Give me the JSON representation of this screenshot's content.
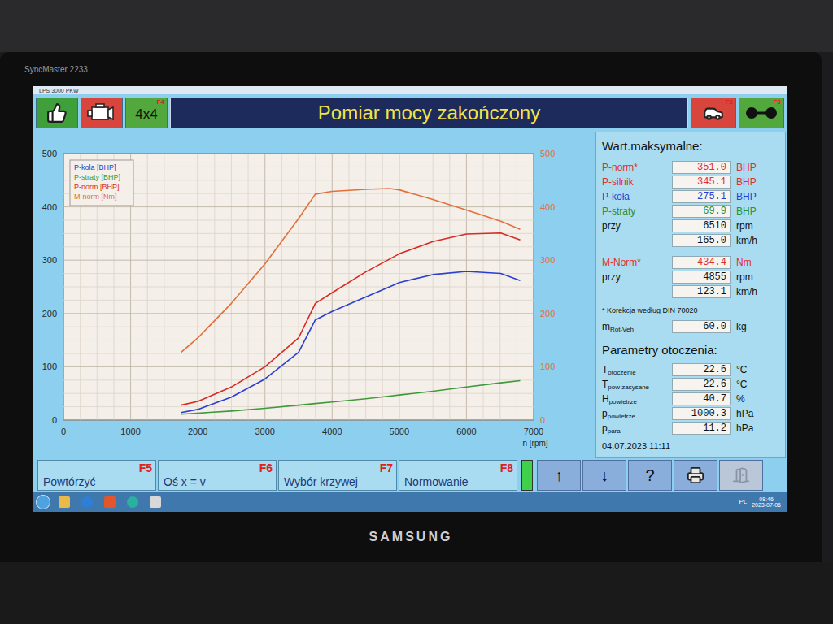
{
  "monitor": {
    "model": "SyncMaster 2233",
    "brand": "SAMSUNG"
  },
  "window": {
    "title": "LPS 3000 PKW"
  },
  "toolbar": {
    "left_buttons": [
      {
        "kind": "ok",
        "color": "#3f9f3a"
      },
      {
        "kind": "engine",
        "color": "#d8453c"
      },
      {
        "kind": "text",
        "label": "4x4",
        "key": "F4",
        "color": "#52a83c"
      }
    ],
    "title": "Pomiar mocy zakończony",
    "right_buttons": [
      {
        "kind": "car",
        "key": "F2",
        "color": "#d8453c"
      },
      {
        "kind": "axle",
        "key": "F3",
        "color": "#52a83c"
      }
    ]
  },
  "chart": {
    "y_ticks_left": [
      "0",
      "100",
      "200",
      "300",
      "400",
      "500"
    ],
    "y_ticks_right": [
      "0",
      "100",
      "200",
      "300",
      "400",
      "500"
    ],
    "x_ticks": [
      "0",
      "1000",
      "2000",
      "3000",
      "4000",
      "5000",
      "6000",
      "7000"
    ],
    "x_label": "n [rpm]",
    "rpm": [
      1750,
      2000,
      2500,
      3000,
      3500,
      3750,
      4000,
      4500,
      4855,
      5000,
      5500,
      6000,
      6510,
      6800
    ],
    "series": [
      {
        "label": "P-koła [BHP]",
        "color": "#2b3fcf",
        "values": [
          14,
          20,
          43,
          77,
          127,
          188,
          204,
          231,
          250,
          258,
          273,
          279,
          275.1,
          262
        ]
      },
      {
        "label": "P-straty [BHP]",
        "color": "#3e9a3a",
        "values": [
          11,
          13,
          17,
          22,
          28,
          31,
          34,
          40,
          45,
          47,
          54,
          62,
          69.9,
          74
        ]
      },
      {
        "label": "P-norm [BHP]",
        "color": "#d62a22",
        "values": [
          28,
          35,
          62,
          100,
          154,
          219,
          239,
          278,
          302,
          312,
          335,
          349,
          351,
          338
        ]
      },
      {
        "label": "M-norm [Nm]",
        "color": "#e2703a",
        "values": [
          127,
          154,
          219,
          293,
          378,
          424,
          429,
          433,
          434.4,
          432,
          414,
          394,
          373,
          358
        ]
      }
    ]
  },
  "maxima": {
    "heading": "Wart.maksymalne:",
    "power": [
      {
        "label": "P-norm*",
        "value": "351.0",
        "unit": "BHP",
        "color": "#e0302a"
      },
      {
        "label": "P-silnik",
        "value": "345.1",
        "unit": "BHP",
        "color": "#e0302a"
      },
      {
        "label": "P-koła",
        "value": "275.1",
        "unit": "BHP",
        "color": "#2b3fcf"
      },
      {
        "label": "P-straty",
        "value": "69.9",
        "unit": "BHP",
        "color": "#2f8f2f"
      },
      {
        "label": "przy",
        "value": "6510",
        "unit": "rpm",
        "color": "#111111"
      },
      {
        "value": "165.0",
        "unit": "km/h",
        "color": "#111111"
      }
    ],
    "torque": [
      {
        "label": "M-Norm*",
        "value": "434.4",
        "unit": "Nm",
        "color": "#e0302a"
      },
      {
        "label": "przy",
        "value": "4855",
        "unit": "rpm",
        "color": "#111111"
      },
      {
        "value": "123.1",
        "unit": "km/h",
        "color": "#111111"
      }
    ],
    "footnote": "* Korekcja według DIN 70020",
    "mass": {
      "label": "m",
      "sub": "Rot-Veh",
      "value": "60.0",
      "unit": "kg"
    }
  },
  "ambient": {
    "heading": "Parametry otoczenia:",
    "rows": [
      {
        "label": "T",
        "sub": "otoczenie",
        "value": "22.6",
        "unit": "°C"
      },
      {
        "label": "T",
        "sub": "pow zasysane",
        "value": "22.6",
        "unit": "°C"
      },
      {
        "label": "H",
        "sub": "powietrze",
        "value": "40.7",
        "unit": "%"
      },
      {
        "label": "p",
        "sub": "powietrze",
        "value": "1000.3",
        "unit": "hPa"
      },
      {
        "label": "p",
        "sub": "para",
        "value": "11.2",
        "unit": "hPa"
      }
    ],
    "date": "04.07.2023 11:11"
  },
  "function_keys": [
    {
      "label": "Powtórzyć",
      "key": "F5"
    },
    {
      "label": "Oś x = v",
      "key": "F6"
    },
    {
      "label": "Wybór krzywej",
      "key": "F7"
    },
    {
      "label": "Normowanie",
      "key": "F8"
    }
  ],
  "indicator": {
    "level": 1
  },
  "nav_buttons": [
    {
      "kind": "text",
      "label": "↑",
      "disabled": false
    },
    {
      "kind": "text",
      "label": "↓",
      "disabled": false
    },
    {
      "kind": "text",
      "label": "?",
      "disabled": false
    },
    {
      "kind": "printer",
      "disabled": false
    },
    {
      "kind": "exit",
      "disabled": true
    }
  ],
  "taskbar": {
    "apps": [
      {
        "kind": "square",
        "color": "#e9b949"
      },
      {
        "kind": "circle",
        "color": "#2f7fd8"
      },
      {
        "kind": "square",
        "color": "#e2562d"
      },
      {
        "kind": "circle",
        "color": "#2bb0a0"
      },
      {
        "kind": "square",
        "color": "#d8d8d8"
      }
    ],
    "tray": {
      "lang": "PL",
      "time": "08:46",
      "date": "2023-07-06"
    }
  }
}
